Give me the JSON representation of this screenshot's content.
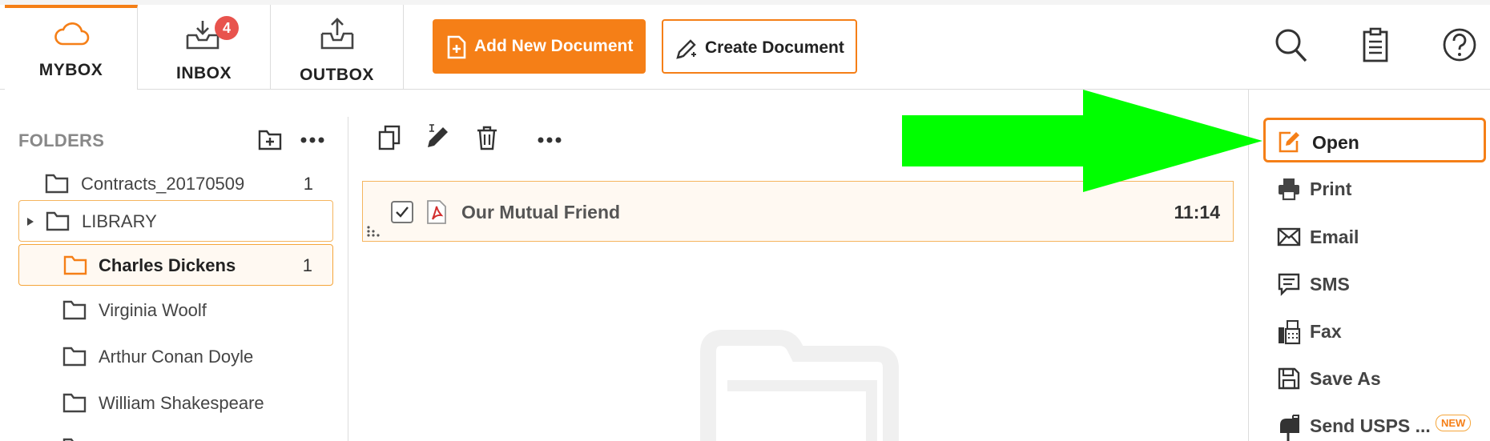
{
  "tabs": [
    {
      "label": "MYBOX",
      "icon": "cloud-icon",
      "active": true
    },
    {
      "label": "INBOX",
      "icon": "inbox-download-icon",
      "badge": "4"
    },
    {
      "label": "OUTBOX",
      "icon": "outbox-upload-icon"
    }
  ],
  "toolbar": {
    "add_label": "Add New Document",
    "create_label": "Create Document"
  },
  "header_icons": [
    "search-icon",
    "clipboard-icon",
    "help-icon"
  ],
  "folders": {
    "heading": "FOLDERS",
    "items": [
      {
        "name": "Contracts_20170509",
        "count": "1"
      },
      {
        "name": "LIBRARY",
        "count": ""
      },
      {
        "name": "Charles Dickens",
        "count": "1"
      },
      {
        "name": "Virginia Woolf",
        "count": ""
      },
      {
        "name": "Arthur Conan Doyle",
        "count": ""
      },
      {
        "name": "William Shakespeare",
        "count": ""
      }
    ]
  },
  "documents": [
    {
      "title": "Our Mutual Friend",
      "time": "11:14",
      "checked": true
    }
  ],
  "actions": {
    "items": [
      {
        "label": "Open",
        "icon": "edit-document-icon"
      },
      {
        "label": "Print",
        "icon": "printer-icon"
      },
      {
        "label": "Email",
        "icon": "envelope-icon"
      },
      {
        "label": "SMS",
        "icon": "chat-icon"
      },
      {
        "label": "Fax",
        "icon": "fax-icon"
      },
      {
        "label": "Save As",
        "icon": "floppy-disk-icon"
      },
      {
        "label": "Send USPS ...",
        "icon": "mailbox-icon",
        "badge": "NEW"
      }
    ]
  },
  "colors": {
    "accent": "#f57f17",
    "annotation_arrow": "#00ff00",
    "badge": "#e8534d"
  }
}
